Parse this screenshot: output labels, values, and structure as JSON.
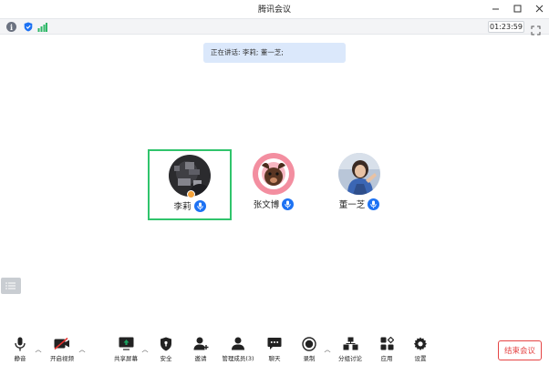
{
  "window": {
    "title": "腾讯会议",
    "minimize_icon": "minimize-icon",
    "maximize_icon": "maximize-icon",
    "close_icon": "close-icon"
  },
  "status_bar": {
    "meeting_timer": "01:23:59",
    "icons": [
      "info-icon",
      "shield-icon",
      "signal-icon",
      "fullscreen-icon"
    ]
  },
  "speaking": {
    "text": "正在讲话: 李莉; 董一芝;"
  },
  "participants": [
    {
      "name": "李莉",
      "active": true,
      "host": true,
      "mic": "mic-on"
    },
    {
      "name": "张文博",
      "active": false,
      "host": false,
      "mic": "mic-on"
    },
    {
      "name": "董一芝",
      "active": false,
      "host": false,
      "mic": "mic-on"
    }
  ],
  "toolbar": {
    "mute": "静音",
    "start_video": "开启视频",
    "share_screen": "共享屏幕",
    "security": "安全",
    "invite": "邀请",
    "manage_members": "管理成员(3)",
    "chat": "聊天",
    "record": "录制",
    "breakout": "分组讨论",
    "apps": "应用",
    "settings": "设置",
    "end_meeting": "结束会议"
  },
  "colors": {
    "accent_blue": "#1d72f3",
    "active_border": "#30c46c",
    "end_red": "#e54545",
    "banner_bg": "#dbe8fb",
    "video_off_red": "#e5312f",
    "share_green": "#1aa260"
  }
}
